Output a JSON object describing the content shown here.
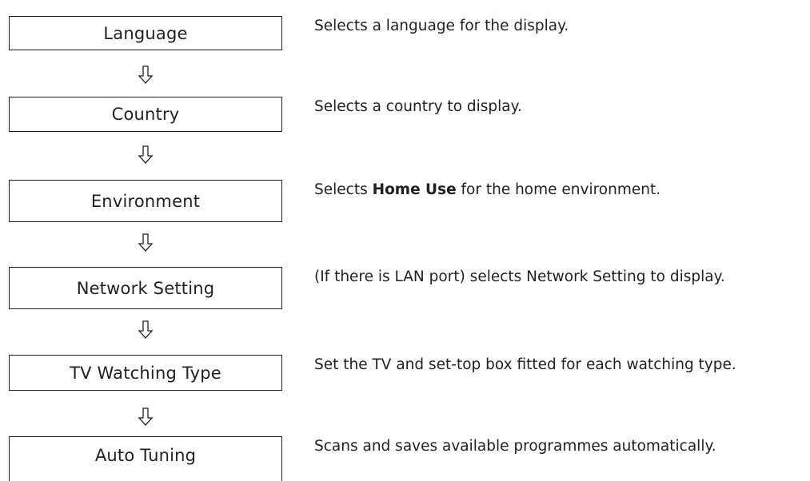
{
  "steps": [
    {
      "label": "Language",
      "description": "Selects a language for the display."
    },
    {
      "label": "Country",
      "description": "Selects a country to display."
    },
    {
      "label": "Environment",
      "description_pre": "Selects ",
      "description_bold": "Home Use",
      "description_post": " for the home environment."
    },
    {
      "label": "Network Setting",
      "description": "(If there is LAN port) selects Network Setting to display."
    },
    {
      "label": "TV Watching Type",
      "description": "Set the TV and set-top box fitted for each watching type."
    },
    {
      "label": "Auto Tuning",
      "description": "Scans and saves available programmes automatically."
    }
  ],
  "arrow_icon": "hollow-down-arrow-icon"
}
